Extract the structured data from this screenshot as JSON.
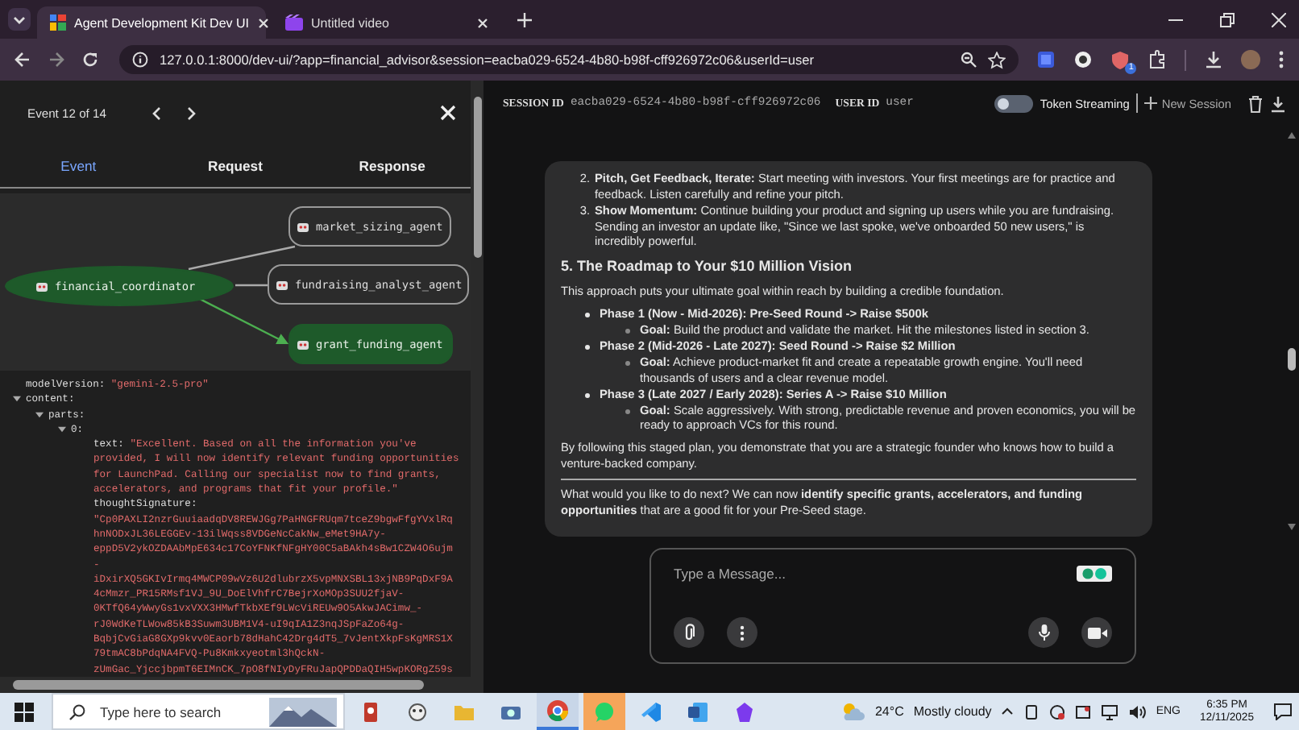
{
  "browser": {
    "tabs": [
      {
        "title": "Agent Development Kit Dev UI",
        "kind": "adk",
        "selected": true
      },
      {
        "title": "Untitled video",
        "kind": "video",
        "selected": false
      }
    ],
    "url": "127.0.0.1:8000/dev-ui/?app=financial_advisor&session=eacba029-6524-4b80-b98f-cff926972c06&userId=user",
    "extension_badge": "1"
  },
  "event_panel": {
    "counter": "Event 12 of 14",
    "tabs": [
      {
        "label": "Event",
        "selected": true
      },
      {
        "label": "Request",
        "selected": false
      },
      {
        "label": "Response",
        "selected": false
      }
    ],
    "graph": {
      "root": {
        "label": "financial_coordinator",
        "active": true
      },
      "agents": [
        {
          "label": "market_sizing_agent",
          "active": false
        },
        {
          "label": "fundraising_analyst_agent",
          "active": false
        },
        {
          "label": "grant_funding_agent",
          "active": true
        }
      ]
    },
    "details": [
      {
        "key": "modelVersion:",
        "value": "\"gemini-2.5-pro\""
      },
      {
        "key": "content:",
        "expanded": true,
        "children": [
          {
            "key": "parts:",
            "expanded": true,
            "children": [
              {
                "key": "0:",
                "expanded": true,
                "children": [
                  {
                    "key": "text:",
                    "value": "\"Excellent. Based on all the information you've provided, I will now identify relevant funding opportunities for LaunchPad. Calling our specialist now to find grants, accelerators, and programs that fit your profile.\""
                  },
                  {
                    "key": "thoughtSignature:",
                    "value_lines": [
                      "\"Cp0PAXLI2nzrGuuiaadqDV8REWJGg7PaHNGFRUqm7tceZ9bgwFfgYVxlRq",
                      "hnNODxJL36LEGGEv-13ilWqss8VDGeNcCakNw_eMet9HA7y-",
                      "eppD5V2ykOZDAAbMpE634c17CoYFNKfNFgHY00C5aBAkh4sBw1CZW4O6ujm",
                      "-",
                      "iDxirXQ5GKIvIrmq4MWCP09wVz6U2dlubrzX5vpMNXSBL13xjNB9PqDxF9A",
                      "4cMmzr_PR15RMsf1VJ_9U_DoElVhfrC7BejrXoMOp3SUU2fjaV-",
                      "0KTfQ64yWwyGs1vxVXX3HMwfTkbXEf9LWcViREUw9O5AkwJACimw_-",
                      "rJ0WdKeTLWow85kB3Suwm3UBM1V4-uI9qIA1Z3nqJSpFaZo64g-",
                      "BqbjCvGiaG8GXp9kvv0Eaorb78dHahC42Drg4dT5_7vJentXkpFsKgMRS1X",
                      "79tmAC8bPdqNA4FVQ-Pu8Kmkxyeotml3hQckN-",
                      "zUmGac_YjccjbpmT6EIMnCK_7pO8fNIyDyFRuJapQPDDaQIH5wpKORgZ59s"
                    ]
                  }
                ]
              }
            ]
          }
        ]
      }
    ]
  },
  "session": {
    "session_id_label": "SESSION ID",
    "session_id": "eacba029-6524-4b80-b98f-cff926972c06",
    "user_id_label": "USER ID",
    "user_id": "user",
    "token_streaming": {
      "label": "Token Streaming",
      "on": false
    },
    "new_session": "New Session"
  },
  "message": [
    {
      "kind": "numbered",
      "items": [
        {
          "number": "2.",
          "text": "**Pitch, Get Feedback, Iterate:** Start meeting with investors. Your first meetings are for practice and feedback. Listen carefully and refine your pitch."
        },
        {
          "number": "3.",
          "text": "**Show Momentum:** Continue building your product and signing up users while you are fundraising. Sending an investor an update like, \"Since we last spoke, we've onboarded 50 new users,\" is incredibly powerful."
        }
      ]
    },
    {
      "kind": "heading",
      "text": "5. The Roadmap to Your $10 Million Vision"
    },
    {
      "kind": "paragraph",
      "text": "This approach puts your ultimate goal within reach by building a credible foundation."
    },
    {
      "kind": "bullets",
      "items": [
        {
          "text": "Phase 1 (Now - Mid-2026): Pre-Seed Round -> Raise $500k",
          "children": [
            {
              "text": "**Goal:** Build the product and validate the market. Hit the milestones listed in section 3."
            }
          ]
        },
        {
          "text": "Phase 2 (Mid-2026 - Late 2027): Seed Round -> Raise $2 Million",
          "children": [
            {
              "text": "**Goal:** Achieve product-market fit and create a repeatable growth engine. You'll need thousands of users and a clear revenue model."
            }
          ]
        },
        {
          "text": "Phase 3 (Late 2027 / Early 2028): Series A -> Raise $10 Million",
          "children": [
            {
              "text": "**Goal:** Scale aggressively. With strong, predictable revenue and proven economics, you will be ready to approach VCs for this round."
            }
          ]
        }
      ]
    },
    {
      "kind": "paragraph",
      "text": "By following this staged plan, you demonstrate that you are a strategic founder who knows how to build a venture-backed company."
    },
    {
      "kind": "rule"
    },
    {
      "kind": "paragraph",
      "text": "What would you like to do next? We can now **identify specific grants, accelerators, and funding opportunities** that are a good fit for your Pre-Seed stage."
    }
  ],
  "composer": {
    "placeholder": "Type a Message..."
  },
  "taskbar": {
    "search_placeholder": "Type here to search",
    "apps": [
      {
        "kind": "game",
        "selected": false
      },
      {
        "kind": "creature",
        "selected": false
      },
      {
        "kind": "folder",
        "selected": false
      },
      {
        "kind": "camera",
        "selected": false
      },
      {
        "kind": "chrome",
        "selected": true
      },
      {
        "kind": "whatsapp",
        "selected": false,
        "flashing": true
      },
      {
        "kind": "vscode",
        "selected": false
      },
      {
        "kind": "word",
        "selected": false
      },
      {
        "kind": "obsidian",
        "selected": false
      }
    ],
    "temperature": "24°C",
    "weather": "Mostly cloudy",
    "language": "ENG",
    "time": "6:35 PM",
    "date": "12/11/2025"
  }
}
